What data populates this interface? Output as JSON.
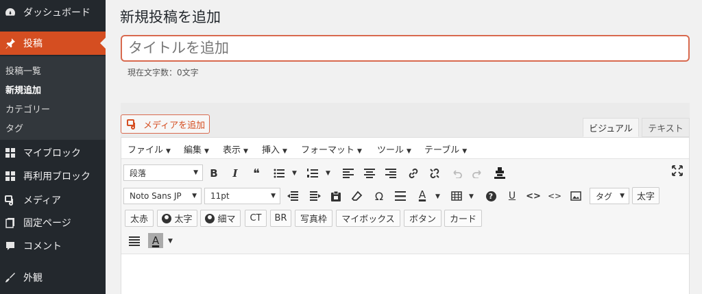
{
  "sidebar": {
    "dashboard": "ダッシュボード",
    "posts": "投稿",
    "sub_all_posts": "投稿一覧",
    "sub_add_new": "新規追加",
    "sub_categories": "カテゴリー",
    "sub_tags": "タグ",
    "my_blocks": "マイブロック",
    "reusable_blocks": "再利用ブロック",
    "media": "メディア",
    "pages": "固定ページ",
    "comments": "コメント",
    "appearance": "外観"
  },
  "main": {
    "page_title": "新規投稿を追加",
    "title_placeholder": "タイトルを追加",
    "char_count": "現在文字数：0文字"
  },
  "editor": {
    "add_media": "メディアを追加",
    "tab_visual": "ビジュアル",
    "tab_text": "テキスト",
    "menubar": [
      "ファイル",
      "編集",
      "表示",
      "挿入",
      "フォーマット",
      "ツール",
      "テーブル"
    ],
    "format_select": "段落",
    "font_select": "Noto Sans JP",
    "size_select": "11pt",
    "tag_select": "タグ",
    "btn_bold_text": "太字",
    "btn_akaaka": "太赤",
    "btn_user_bold": "太字",
    "btn_user_thin": "細マ",
    "btn_ct": "CT",
    "btn_br": "BR",
    "btn_photo_frame": "写真枠",
    "btn_mybox": "マイボックス",
    "btn_button": "ボタン",
    "btn_card": "カード",
    "glyph_bold": "B",
    "glyph_italic": "I",
    "glyph_quote": "❝",
    "glyph_omega": "Ω",
    "glyph_textcolor": "A",
    "glyph_underline": "U",
    "glyph_help": "?",
    "glyph_code1": "<>",
    "glyph_code2": "<>",
    "glyph_bgcolor": "A"
  },
  "colors": {
    "sidebar_bg": "#23282d",
    "accent": "#d54e21",
    "title_border": "#d8694e"
  }
}
